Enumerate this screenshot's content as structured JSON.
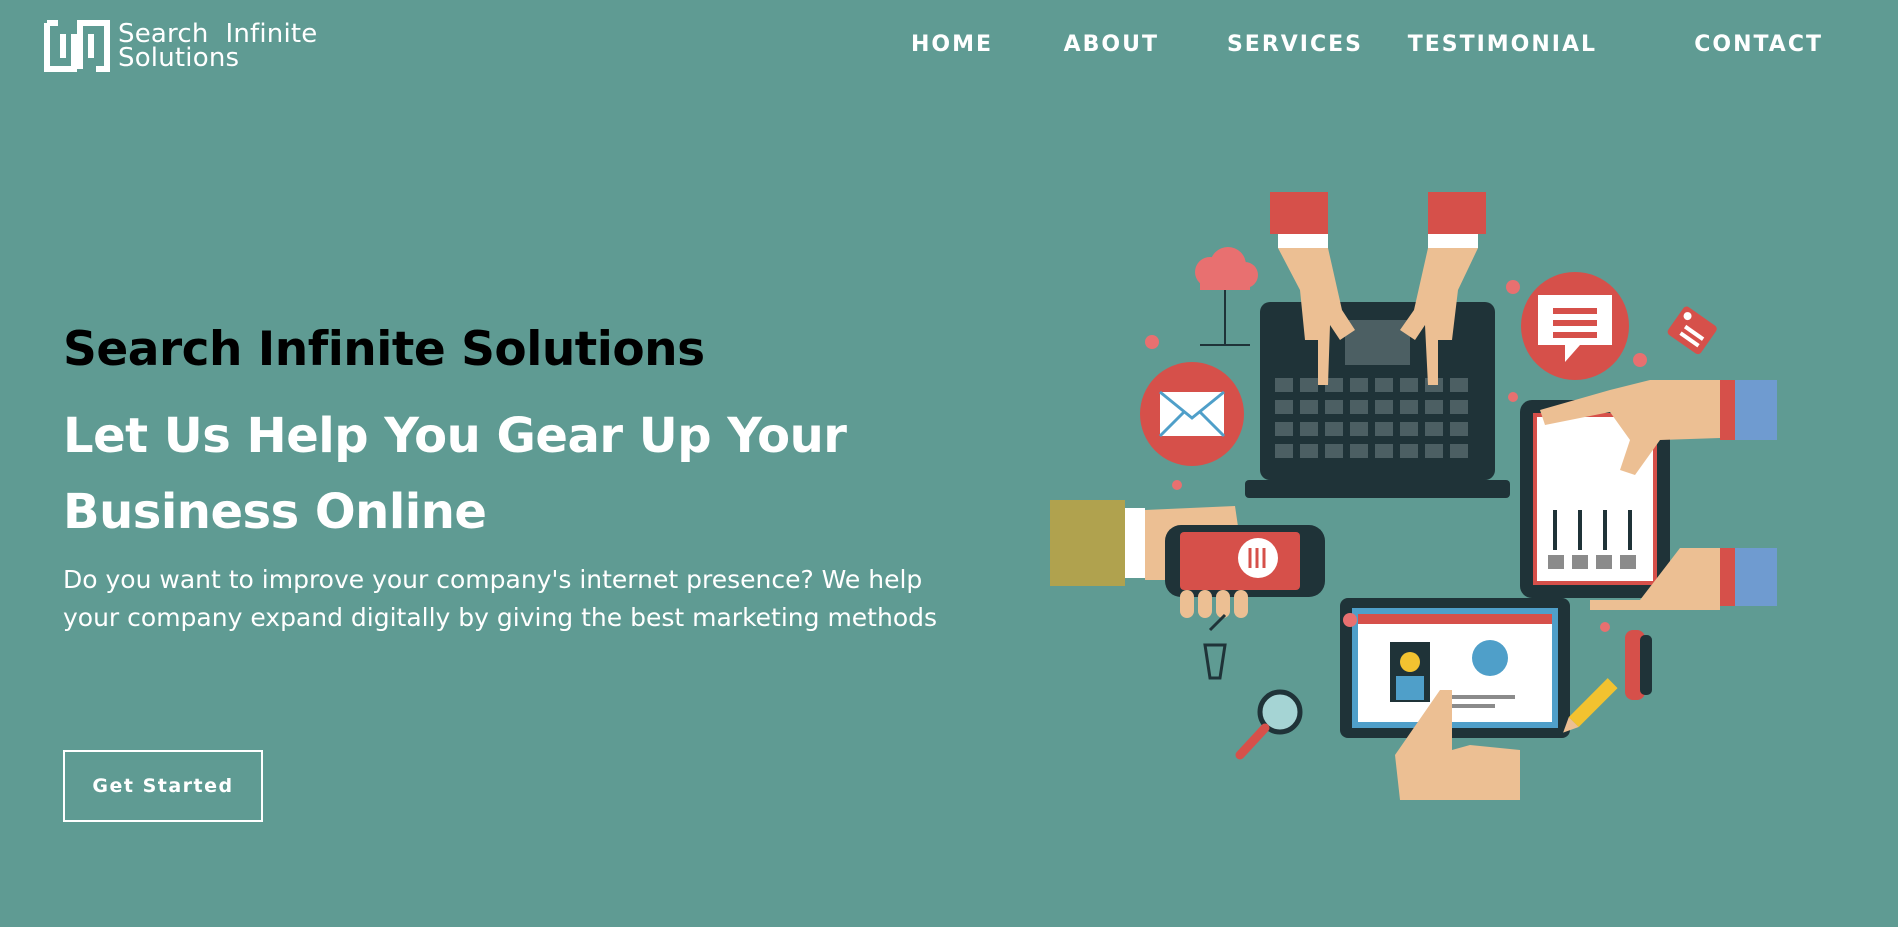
{
  "brand": {
    "line1": "Search  Infinite",
    "line2": "Solutions"
  },
  "nav": {
    "items": [
      {
        "label": "HOME"
      },
      {
        "label": "ABOUT"
      },
      {
        "label": "SERVICES"
      },
      {
        "label": "TESTIMONIAL"
      },
      {
        "label": "CONTACT"
      }
    ]
  },
  "hero": {
    "title": "Search Infinite Solutions",
    "subtitle": "Let Us Help You Gear Up Your Business Online",
    "description": "Do you want to improve your company's internet presence? We help your company expand digitally by giving the best marketing methods",
    "cta_label": "Get Started"
  },
  "colors": {
    "background": "#5f9b93",
    "text_light": "#ffffff",
    "text_dark": "#000000",
    "accent_red": "#d6504a",
    "device_dark": "#1f3338"
  },
  "illustration": {
    "icons": [
      "laptop-icon",
      "tablet-icon",
      "smartphone-icon",
      "monitor-icon",
      "email-icon",
      "chat-icon",
      "cloud-icon",
      "tag-icon",
      "basket-icon",
      "magnifier-icon",
      "pencil-icon",
      "telephone-icon"
    ]
  }
}
